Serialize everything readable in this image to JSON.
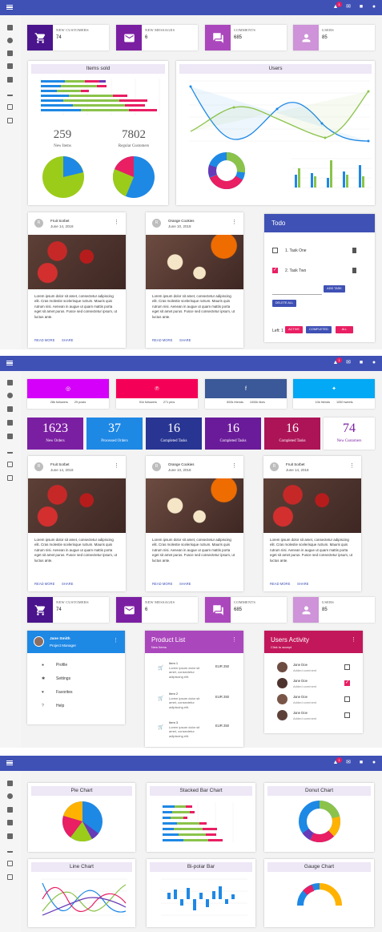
{
  "top_badge": "1",
  "stats": {
    "new_customers": {
      "label": "NEW CUSTOMERS",
      "value": "74"
    },
    "new_messages": {
      "label": "NEW MESSAGES",
      "value": "6"
    },
    "comments": {
      "label": "COMMENTS",
      "value": "685"
    },
    "users": {
      "label": "USERS",
      "value": "85"
    }
  },
  "items_sold": {
    "title": "Items sold",
    "new_items": "259",
    "new_items_label": "New Items",
    "regular": "7802",
    "regular_label": "Regular Customers"
  },
  "users_panel": {
    "title": "Users"
  },
  "posts": [
    {
      "initial": "R",
      "name": "Fruit Sorbet",
      "date": "June 14, 2018"
    },
    {
      "initial": "R",
      "name": "Orange Cookies",
      "date": "June 10, 2018"
    }
  ],
  "post_text": "Lorem ipsum dolor sit amet, consectetur adipiscing elit. Cras molestie scelerisque rutrum. Mauris quis rutrum nisi. Aenean in augue ut quam mattis porta eget sit amet purus. Fusce sed consectetur ipsum, ut luctus ante.",
  "read_more": "READ MORE",
  "share": "SHARE",
  "todo": {
    "title": "Todo",
    "task1": "1. Task One",
    "task2": "2. Task Two",
    "add": "ADD TASK",
    "delete_all": "DELETE ALL",
    "left": "Left: 1",
    "active": "ACTIVE",
    "completed": "COMPLETED",
    "all": "ALL"
  },
  "social": [
    {
      "icon": "instagram-icon",
      "a": "28k followers",
      "b": "29 posts"
    },
    {
      "icon": "pinterest-icon",
      "a": "91k followers",
      "b": "271 pins"
    },
    {
      "icon": "facebook-icon",
      "a": "500k friends",
      "b": "1000k likes"
    },
    {
      "icon": "twitter-icon",
      "a": "10k friends",
      "b": "1050 tweets"
    }
  ],
  "tiles": [
    {
      "n": "1623",
      "l": "New Orders"
    },
    {
      "n": "37",
      "l": "Processed Orders"
    },
    {
      "n": "16",
      "l": "Completed Tasks"
    },
    {
      "n": "16",
      "l": "Completed Tasks"
    },
    {
      "n": "16",
      "l": "Completed Tasks"
    },
    {
      "n": "74",
      "l": "New Customers"
    }
  ],
  "profile": {
    "name": "Jane Smith",
    "role": "Project Manager",
    "profile": "Profile",
    "settings": "Settings",
    "favorites": "Favorites",
    "help": "Help"
  },
  "products": {
    "title": "Product List",
    "sub": "New Items",
    "i1": "Item 1",
    "i2": "Item 2",
    "i3": "Item 3",
    "desc": "Lorem ipsum dolor sit amet, consectetur adipiscing elit.",
    "price": "EUR 250"
  },
  "activity": {
    "title": "Users Activity",
    "sub": "Click to accept",
    "name": "Jane Doe",
    "comment": "Added comment"
  },
  "charts": {
    "pie": "Pie Chart",
    "stacked": "Stacked Bar Chart",
    "donut": "Donut Chart",
    "line": "Line Chart",
    "bipolar": "Bi-polar Bar",
    "gauge": "Gauge Chart"
  }
}
